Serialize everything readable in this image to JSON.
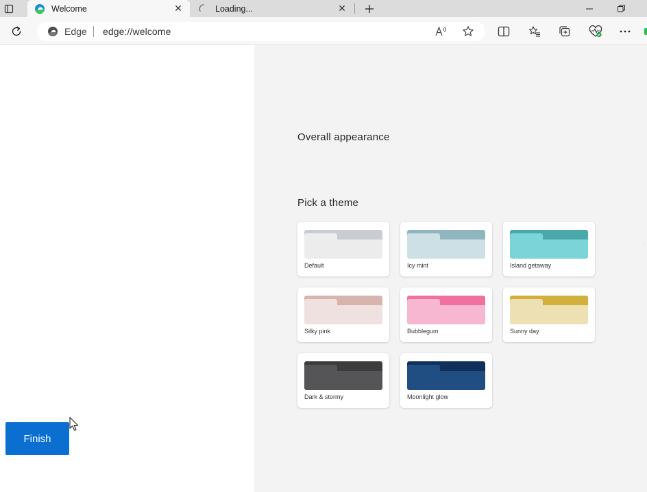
{
  "tabs": [
    {
      "title": "Welcome",
      "active": true,
      "favicon": "edge-icon"
    },
    {
      "title": "Loading...",
      "active": false,
      "favicon": "loading-spinner-icon"
    }
  ],
  "tab_close_glyph": "✕",
  "new_tab_glyph": "+",
  "window_controls": {
    "minimize": "—",
    "restore": "❐"
  },
  "omnibox": {
    "site_label": "Edge",
    "url": "edge://welcome"
  },
  "toolbar_icons": [
    "refresh-icon",
    "read-aloud-icon",
    "favorite-star-icon",
    "split-screen-icon",
    "favorites-list-icon",
    "collections-icon",
    "browser-essentials-icon",
    "more-menu-icon"
  ],
  "page": {
    "overall_appearance": "Overall appearance",
    "pick_theme": "Pick a theme",
    "finish": "Finish"
  },
  "themes": [
    {
      "name": "Default",
      "bar": "#c9ccd1",
      "tab": "#eceeef",
      "body": "#ececec"
    },
    {
      "name": "Icy mint",
      "bar": "#8fb5bf",
      "tab": "#cde0e5",
      "body": "#cde0e5"
    },
    {
      "name": "Island getaway",
      "bar": "#4aa7aa",
      "tab": "#7ad4d8",
      "body": "#7ad4d8"
    },
    {
      "name": "Silky pink",
      "bar": "#d8b4ae",
      "tab": "#efe1df",
      "body": "#efe1df"
    },
    {
      "name": "Bubblegum",
      "bar": "#f0709f",
      "tab": "#f7b7d1",
      "body": "#f7b7d1"
    },
    {
      "name": "Sunny day",
      "bar": "#d1b13c",
      "tab": "#ede0b2",
      "body": "#ede0b2"
    },
    {
      "name": "Dark & stormy",
      "bar": "#3c3c3f",
      "tab": "#555558",
      "body": "#555558"
    },
    {
      "name": "Moonlight glow",
      "bar": "#10305b",
      "tab": "#204d82",
      "body": "#204d82"
    }
  ],
  "colors": {
    "accent": "#0a6fd1",
    "panel_bg": "#f3f3f3",
    "tabstrip_bg": "#dcdcdc"
  }
}
